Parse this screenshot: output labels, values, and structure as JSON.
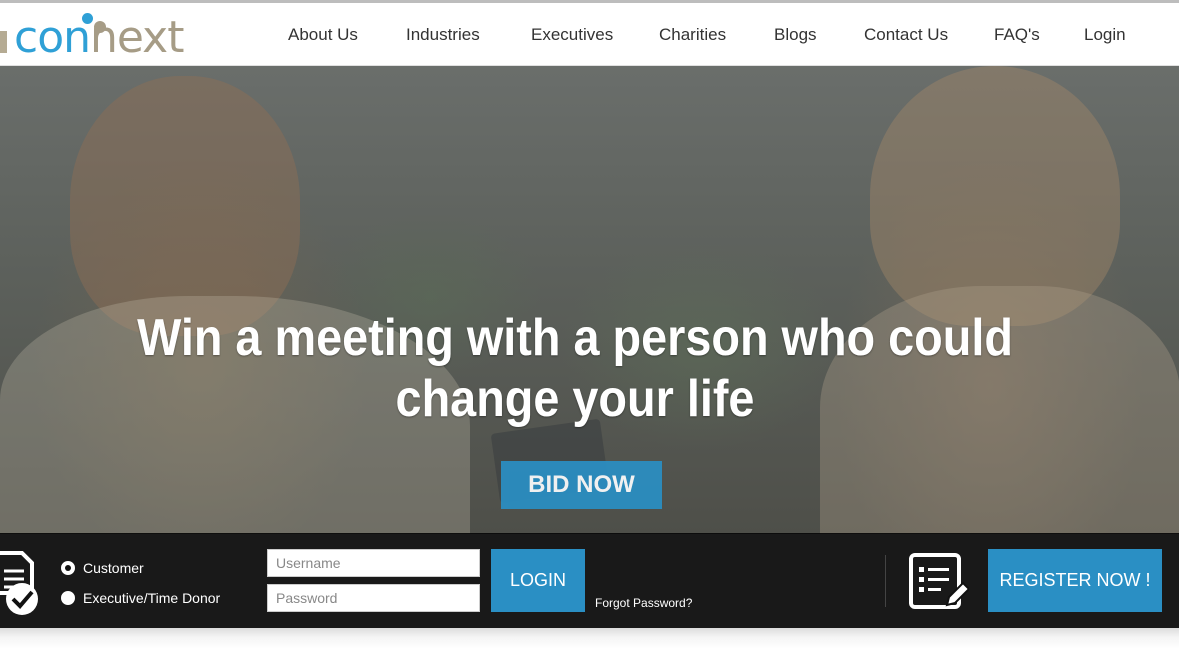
{
  "brand": {
    "logo_part1": "con",
    "logo_part2": "next",
    "colors": {
      "primary": "#2fa0d6",
      "secondary": "#a69c86",
      "button": "#2a8fc4"
    }
  },
  "nav": {
    "items": [
      {
        "label": "About Us"
      },
      {
        "label": "Industries"
      },
      {
        "label": "Executives"
      },
      {
        "label": "Charities"
      },
      {
        "label": "Blogs"
      },
      {
        "label": "Contact Us"
      },
      {
        "label": "FAQ's"
      },
      {
        "label": "Login"
      }
    ]
  },
  "hero": {
    "headline_line1": "Win a meeting with a person who could",
    "headline_line2": "change your life",
    "cta_label": "BID NOW"
  },
  "login_strip": {
    "account_types": [
      {
        "label": "Customer",
        "selected": true
      },
      {
        "label": "Executive/Time Donor",
        "selected": false
      }
    ],
    "username_placeholder": "Username",
    "password_placeholder": "Password",
    "login_label": "LOGIN",
    "forgot_label": "Forgot Password?",
    "register_label": "REGISTER NOW !",
    "icons": {
      "left": "document-check-icon",
      "register": "list-edit-icon"
    }
  }
}
